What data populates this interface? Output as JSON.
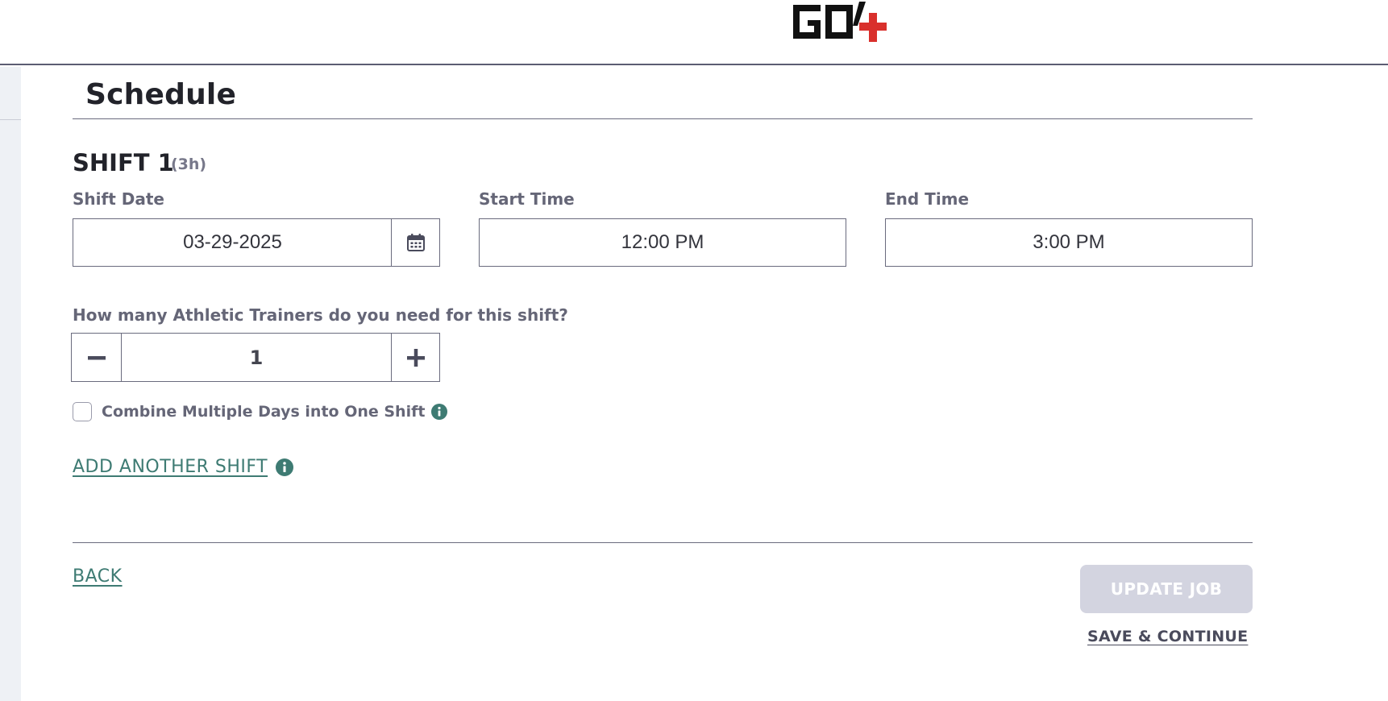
{
  "header": {
    "logo_text": "GO4"
  },
  "schedule": {
    "title": "Schedule",
    "shift": {
      "heading": "SHIFT 1",
      "duration": "(3h)",
      "date_label": "Shift Date",
      "date_value": "03-29-2025",
      "start_label": "Start Time",
      "start_value": "12:00 PM",
      "end_label": "End Time",
      "end_value": "3:00 PM"
    },
    "trainers_question": "How many Athletic Trainers do you need for this shift?",
    "trainers_count": "1",
    "combine_label": "Combine Multiple Days into One Shift",
    "combine_checked": false,
    "add_shift_label": "ADD ANOTHER SHIFT"
  },
  "footer": {
    "back_label": "BACK",
    "update_label": "UPDATE JOB",
    "save_label": "SAVE & CONTINUE"
  },
  "colors": {
    "accent_teal": "#3e7b73",
    "logo_red": "#d9302c",
    "disabled_button": "#d3d4e0",
    "label_gray": "#656677"
  },
  "icons": {
    "calendar": "calendar-icon",
    "minus": "minus-icon",
    "plus": "plus-icon",
    "info": "info-icon"
  }
}
